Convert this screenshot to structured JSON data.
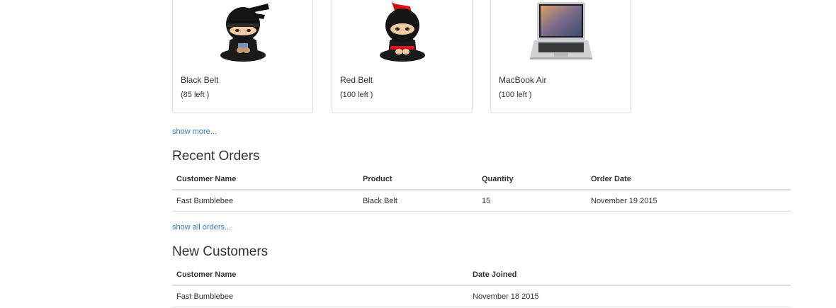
{
  "products": [
    {
      "name": "Black Belt",
      "stock": "(85 left )",
      "image": "ninja-black-belt"
    },
    {
      "name": "Red Belt",
      "stock": "(100 left )",
      "image": "ninja-red-belt"
    },
    {
      "name": "MacBook Air",
      "stock": "(100 left )",
      "image": "macbook-laptop"
    }
  ],
  "links": {
    "show_more": "show more...",
    "show_all_orders": "show all orders..."
  },
  "recent_orders": {
    "title": "Recent Orders",
    "columns": [
      "Customer Name",
      "Product",
      "Quantity",
      "Order Date"
    ],
    "rows": [
      [
        "Fast Bumblebee",
        "Black Belt",
        "15",
        "November 19 2015"
      ]
    ]
  },
  "new_customers": {
    "title": "New Customers",
    "columns": [
      "Customer Name",
      "Date Joined"
    ],
    "rows": [
      [
        "Fast Bumblebee",
        "November 18 2015"
      ]
    ]
  },
  "colors": {
    "link": "#337ab7",
    "border": "#dddddd",
    "text": "#333333"
  }
}
